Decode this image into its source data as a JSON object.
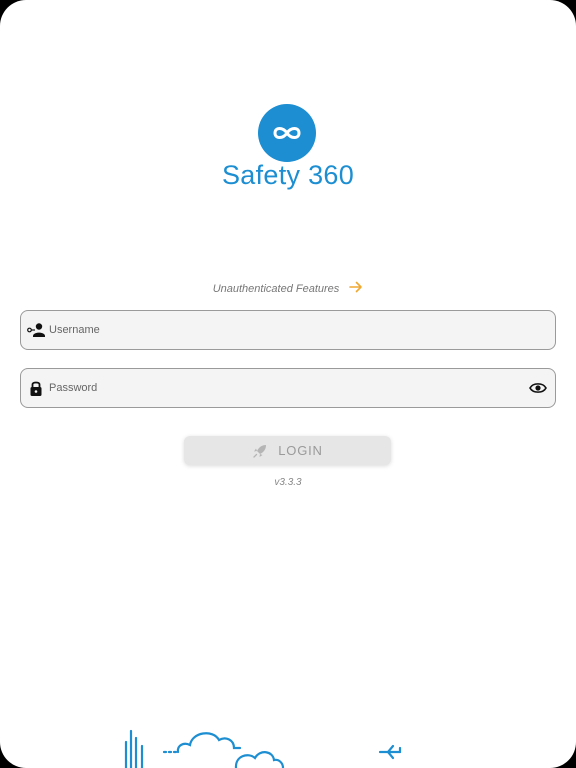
{
  "brand": {
    "name": "Safety 360",
    "logo_icon": "infinity-icon",
    "accent_color": "#1c8ed1"
  },
  "unauthenticated": {
    "label": "Unauthenticated Features",
    "icon": "arrow-right-icon",
    "icon_color": "#f0a830"
  },
  "username": {
    "placeholder": "Username",
    "value": "",
    "icon": "user-key-icon"
  },
  "password": {
    "placeholder": "Password",
    "value": "",
    "icon": "lock-icon",
    "toggle_icon": "eye-icon"
  },
  "login": {
    "label": "LOGIN",
    "icon": "rocket-icon",
    "enabled": false
  },
  "version": "v3.3.3",
  "illustration": {
    "name": "skyline-clouds-plane-illustration"
  }
}
